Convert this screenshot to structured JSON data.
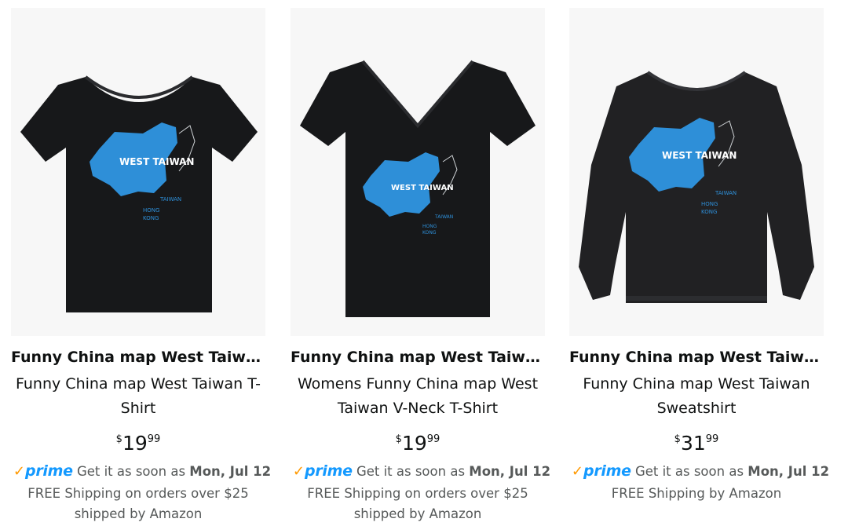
{
  "products": [
    {
      "brand": "Funny China map West Taiwa...",
      "title_line1": "Funny China map West Taiwan T-",
      "title_line2": "Shirt",
      "price_symbol": "$",
      "price_whole": "19",
      "price_fraction": "99",
      "prime_label": "prime",
      "delivery_prefix": "Get it as soon as",
      "delivery_date": "Mon, Jul 12",
      "shipping_line1": "FREE Shipping on orders over $25",
      "shipping_line2": "shipped by Amazon",
      "image": {
        "garment": "t-shirt",
        "print_title": "WEST TAIWAN",
        "print_label1": "TAIWAN",
        "print_label2": "HONG",
        "print_label3": "KONG"
      }
    },
    {
      "brand": "Funny China map West Taiwa...",
      "title_line1": "Womens Funny China map West",
      "title_line2": "Taiwan V-Neck T-Shirt",
      "price_symbol": "$",
      "price_whole": "19",
      "price_fraction": "99",
      "prime_label": "prime",
      "delivery_prefix": "Get it as soon as",
      "delivery_date": "Mon, Jul 12",
      "shipping_line1": "FREE Shipping on orders over $25",
      "shipping_line2": "shipped by Amazon",
      "image": {
        "garment": "v-neck",
        "print_title": "WEST TAIWAN",
        "print_label1": "TAIWAN",
        "print_label2": "HONG",
        "print_label3": "KONG"
      }
    },
    {
      "brand": "Funny China map West Taiwa...",
      "title_line1": "Funny China map West Taiwan",
      "title_line2": "Sweatshirt",
      "price_symbol": "$",
      "price_whole": "31",
      "price_fraction": "99",
      "prime_label": "prime",
      "delivery_prefix": "Get it as soon as",
      "delivery_date": "Mon, Jul 12",
      "shipping_line1": "FREE Shipping by Amazon",
      "shipping_line2": "",
      "image": {
        "garment": "sweatshirt",
        "print_title": "WEST TAIWAN",
        "print_label1": "TAIWAN",
        "print_label2": "HONG",
        "print_label3": "KONG"
      }
    }
  ],
  "colors": {
    "prime_check": "#ff9900",
    "prime_word": "#1399ff",
    "map_blue": "#2e8fd8",
    "garment": "#1b1b1d"
  }
}
